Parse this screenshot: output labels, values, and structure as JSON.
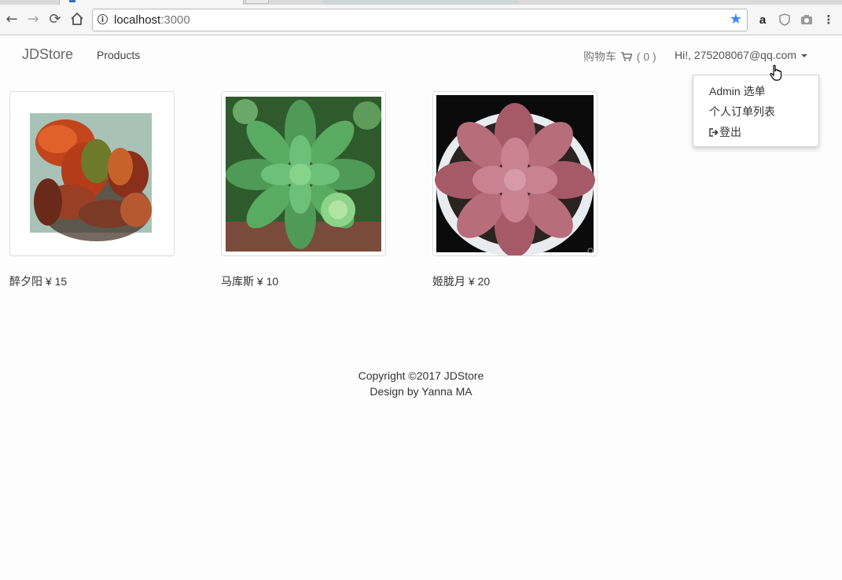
{
  "browser": {
    "address": {
      "host": "localhost",
      "port": ":3000"
    },
    "icons": [
      "back-icon",
      "forward-icon",
      "reload-icon",
      "home-icon",
      "info-icon",
      "bookmark-star-icon",
      "amazon-icon",
      "shield-icon",
      "camera-icon",
      "menu-icon"
    ]
  },
  "navbar": {
    "brand": "JDStore",
    "products_link": "Products",
    "cart_label": "购物车",
    "cart_count": "( 0 )",
    "user_greeting": "Hi!, 275208067@qq.com"
  },
  "dropdown": {
    "items": [
      {
        "label": "Admin 选单"
      },
      {
        "label": "个人订单列表"
      },
      {
        "label": "登出"
      }
    ]
  },
  "products": [
    {
      "name": "醉夕阳",
      "price": "¥ 15"
    },
    {
      "name": "马库斯",
      "price": "¥ 10"
    },
    {
      "name": "姬胧月",
      "price": "¥ 20"
    }
  ],
  "footer": {
    "copyright": "Copyright ©2017 JDStore",
    "design": "Design by Yanna MA"
  },
  "colors": {
    "accent": "#3d87f5",
    "text": "#333333",
    "muted": "#777777"
  }
}
